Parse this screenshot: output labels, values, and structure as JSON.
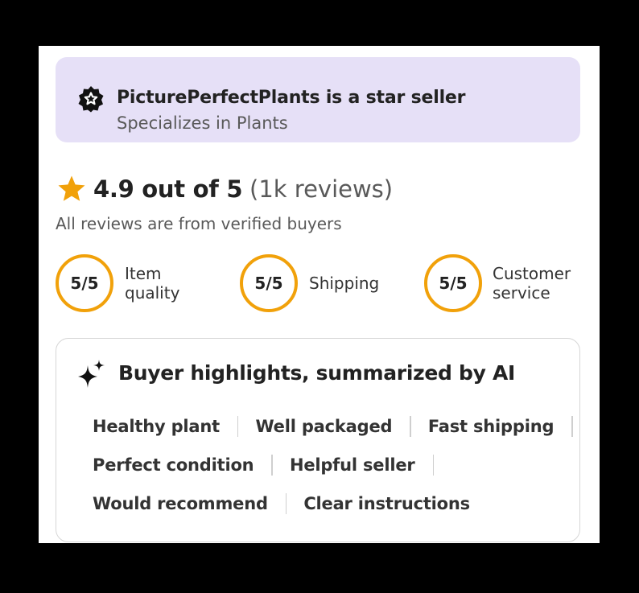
{
  "banner": {
    "title": "PicturePerfectPlants is a star seller",
    "subtitle": "Specializes in Plants",
    "icon": "star-badge-icon",
    "background": "#e6e0f7"
  },
  "rating": {
    "score_text": "4.9 out of 5",
    "count_text": "(1k reviews)",
    "verified_text": "All reviews are from verified buyers",
    "star_icon": "star-icon",
    "star_color": "#f1a10a"
  },
  "scores": [
    {
      "value": "5/5",
      "label": "Item\nquality"
    },
    {
      "value": "5/5",
      "label": "Shipping"
    },
    {
      "value": "5/5",
      "label": "Customer\nservice"
    }
  ],
  "highlights": {
    "title": "Buyer highlights, summarized by AI",
    "icon": "sparkle-icon",
    "rows": [
      [
        "Healthy plant",
        "Well packaged",
        "Fast shipping"
      ],
      [
        "Perfect condition",
        "Helpful seller"
      ],
      [
        "Would recommend",
        "Clear instructions"
      ]
    ]
  }
}
